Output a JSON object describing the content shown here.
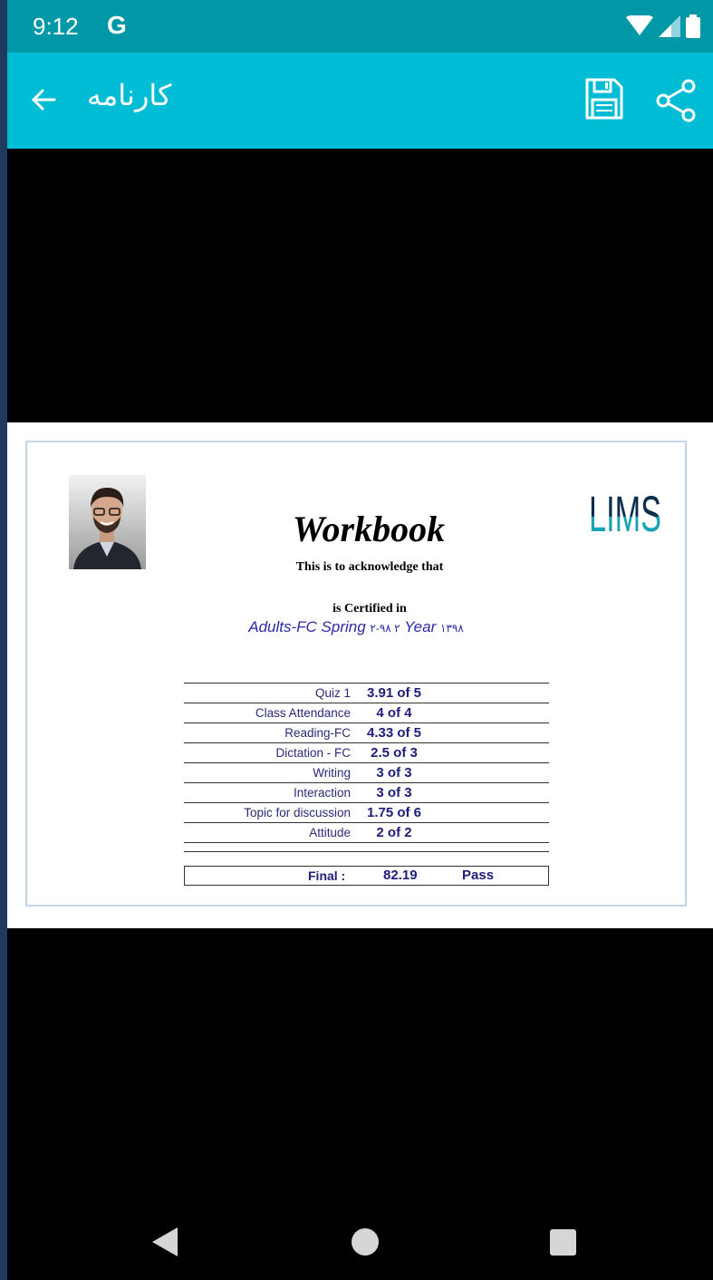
{
  "status_bar": {
    "time": "9:12",
    "g_label": "G"
  },
  "app_bar": {
    "title": "کارنامه"
  },
  "certificate": {
    "title": "Workbook",
    "acknowledge": "This is to acknowledge that",
    "certified_in": "is Certified in",
    "course": "Adults-FC Spring",
    "course_code": "۲-۹۸ ۲",
    "year_label": "Year",
    "year_value": "۱۳۹۸",
    "logo_text": "LIMS",
    "grades": [
      {
        "label": "Quiz 1",
        "value": "3.91 of 5"
      },
      {
        "label": "Class Attendance",
        "value": "4 of 4"
      },
      {
        "label": "Reading-FC",
        "value": "4.33 of 5"
      },
      {
        "label": "Dictation - FC",
        "value": "2.5 of 3"
      },
      {
        "label": "Writing",
        "value": "3 of 3"
      },
      {
        "label": "Interaction",
        "value": "3 of 3"
      },
      {
        "label": "Topic for discussion",
        "value": "1.75 of 6"
      },
      {
        "label": "Attitude",
        "value": "2 of 2"
      }
    ],
    "final_label": "Final :",
    "final_score": "82.19",
    "final_status": "Pass"
  },
  "colors": {
    "app_bar": "#00bcd4",
    "status_bar": "#0097a7",
    "grade_text": "#1d1d7a",
    "logo": "#1aa3b3"
  },
  "icons": {
    "back": "arrow-left-icon",
    "save": "floppy-disk-icon",
    "share": "share-icon",
    "wifi": "wifi-icon",
    "signal": "signal-icon",
    "battery": "battery-icon"
  }
}
